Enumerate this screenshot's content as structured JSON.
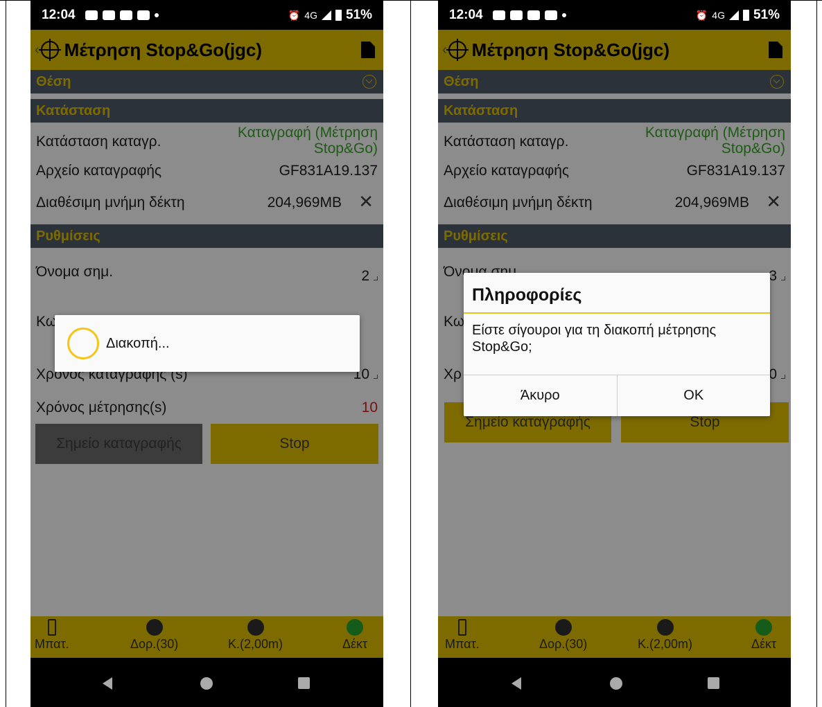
{
  "left": {
    "status": {
      "time": "12:04",
      "net": "4G",
      "battery": "51%"
    },
    "appbar": {
      "title": "Μέτρηση Stop&Go(jgc)"
    },
    "sections": {
      "position": "Θέση",
      "status": "Κατάσταση",
      "settings": "Ρυθμίσεις"
    },
    "rows": {
      "record_state_label": "Κατάσταση καταγρ.",
      "record_state_value": "Καταγραφή (Μέτρηση Stop&Go)",
      "log_file_label": "Αρχείο καταγραφής",
      "log_file_value": "GF831A19.137",
      "memory_label": "Διαθέσιμη μνήμη δέκτη",
      "memory_value": "204,969MB",
      "point_name_label": "Όνομα σημ.",
      "point_name_value": "2",
      "code_label": "Κω",
      "log_time_label": "Χρονος καταγραφης (s)",
      "log_time_value": "10",
      "measure_time_label": "Χρόνος μέτρησης(s)",
      "measure_time_value": "10"
    },
    "buttons": {
      "record_point": "Σημείο καταγραφής",
      "stop": "Stop"
    },
    "dialog": {
      "text": "Διακοπή..."
    },
    "bottombar": {
      "battery": "Μπατ.",
      "satellites": "Δορ.(30)",
      "pole": "Κ.(2,00m)",
      "receiver": "Δέκτ"
    }
  },
  "right": {
    "status": {
      "time": "12:04",
      "net": "4G",
      "battery": "51%"
    },
    "appbar": {
      "title": "Μέτρηση Stop&Go(jgc)"
    },
    "sections": {
      "position": "Θέση",
      "status": "Κατάσταση",
      "settings": "Ρυθμίσεις"
    },
    "rows": {
      "record_state_label": "Κατάσταση καταγρ.",
      "record_state_value": "Καταγραφή (Μέτρηση Stop&Go)",
      "log_file_label": "Αρχείο καταγραφής",
      "log_file_value": "GF831A19.137",
      "memory_label": "Διαθέσιμη μνήμη δέκτη",
      "memory_value": "204,969MB",
      "point_name_label": "Όνομα σημ.",
      "point_name_value": "3",
      "code_label": "Κω",
      "log_time_label": "Χρ",
      "log_time_value": "0"
    },
    "buttons": {
      "record_point": "Σημείο καταγραφής",
      "stop": "Stop"
    },
    "dialog": {
      "title": "Πληροφορίες",
      "message": "Είστε σίγουροι για τη διακοπή μέτρησης Stop&Go;",
      "cancel": "Άκυρο",
      "ok": "OK"
    },
    "bottombar": {
      "battery": "Μπατ.",
      "satellites": "Δορ.(30)",
      "pole": "Κ.(2,00m)",
      "receiver": "Δέκτ"
    }
  }
}
